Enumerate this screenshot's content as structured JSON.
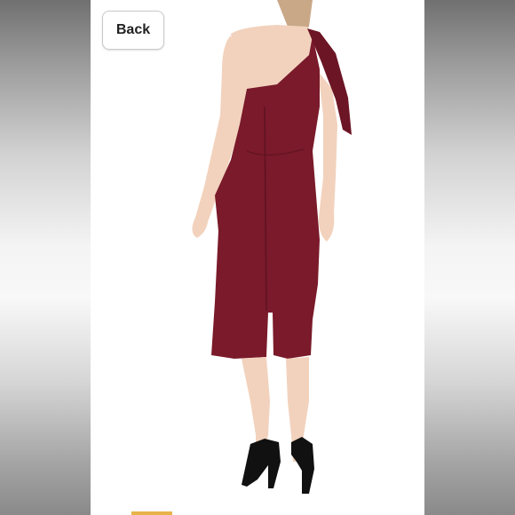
{
  "viewer": {
    "back_label": "Back",
    "colors": {
      "dress": "#7a1a2a",
      "skin": "#f2d2bd",
      "shoe": "#111111",
      "accent": "#e7b34a"
    },
    "image_subject": "woman-in-burgundy-one-shoulder-midi-dress",
    "icon": "back-arrow-icon"
  }
}
